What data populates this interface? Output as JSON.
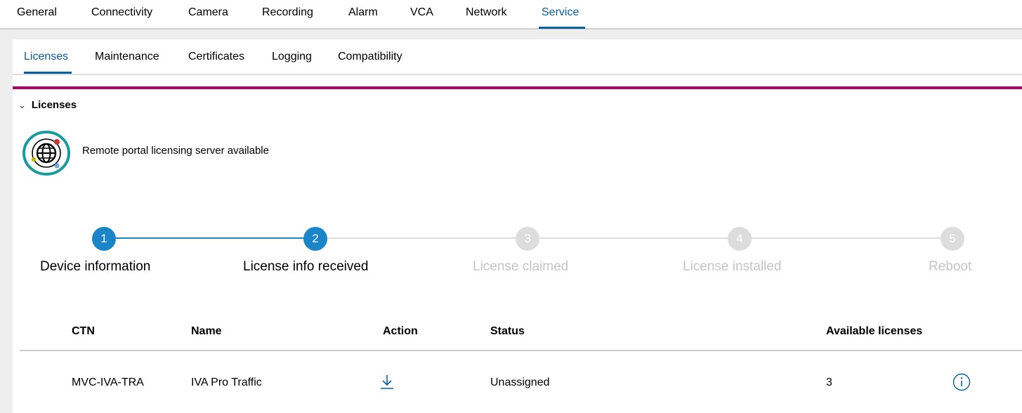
{
  "top_nav": {
    "tabs": [
      {
        "label": "General"
      },
      {
        "label": "Connectivity"
      },
      {
        "label": "Camera"
      },
      {
        "label": "Recording"
      },
      {
        "label": "Alarm"
      },
      {
        "label": "VCA"
      },
      {
        "label": "Network"
      },
      {
        "label": "Service",
        "active": true
      }
    ]
  },
  "sub_nav": {
    "tabs": [
      {
        "label": "Licenses",
        "active": true
      },
      {
        "label": "Maintenance"
      },
      {
        "label": "Certificates"
      },
      {
        "label": "Logging"
      },
      {
        "label": "Compatibility"
      }
    ]
  },
  "section": {
    "title": "Licenses",
    "expanded": true
  },
  "portal": {
    "icon": "globe-icon",
    "status_text": "Remote portal licensing server available"
  },
  "stepper": {
    "current_step": 2,
    "steps": [
      {
        "number": "1",
        "label": "Device information"
      },
      {
        "number": "2",
        "label": "License info received"
      },
      {
        "number": "3",
        "label": "License claimed"
      },
      {
        "number": "4",
        "label": "License installed"
      },
      {
        "number": "5",
        "label": "Reboot"
      }
    ]
  },
  "licenses_table": {
    "columns": [
      "CTN",
      "Name",
      "Action",
      "Status",
      "Available licenses"
    ],
    "rows": [
      {
        "ctn": "MVC-IVA-TRA",
        "name": "IVA Pro Traffic",
        "action_icon": "download-icon",
        "status": "Unassigned",
        "available": "3",
        "info_icon": "info-icon"
      }
    ]
  },
  "colors": {
    "accent_blue": "#0a5e9e",
    "step_active": "#1a86c8",
    "step_inactive": "#dddddd",
    "section_bar": "#b0006a",
    "highlight_ring": "#1a9b9b"
  }
}
